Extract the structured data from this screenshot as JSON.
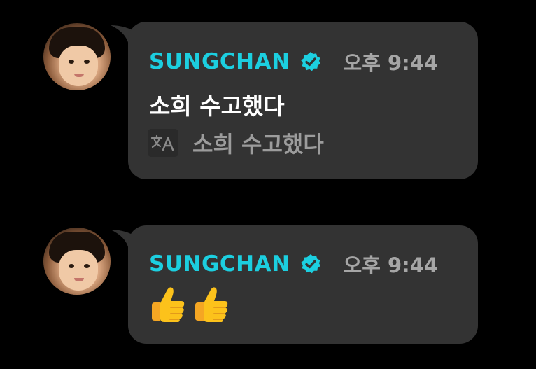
{
  "messages": [
    {
      "username": "SUNGCHAN",
      "verified_icon": "verified-badge-icon",
      "time": "오후 9:44",
      "text": "소희 수고했다",
      "translation_icon": "translate-icon",
      "translation_text": "소희 수고했다"
    },
    {
      "username": "SUNGCHAN",
      "verified_icon": "verified-badge-icon",
      "time": "오후 9:44",
      "emoji": [
        "thumbs-up-icon",
        "thumbs-up-icon"
      ]
    }
  ],
  "colors": {
    "background": "#000000",
    "bubble": "#333333",
    "username": "#1ccfe0",
    "time": "#a6a6a6",
    "message_text": "#ffffff",
    "translation_text": "#9c9c9c",
    "emoji": "#fcbf2f"
  }
}
